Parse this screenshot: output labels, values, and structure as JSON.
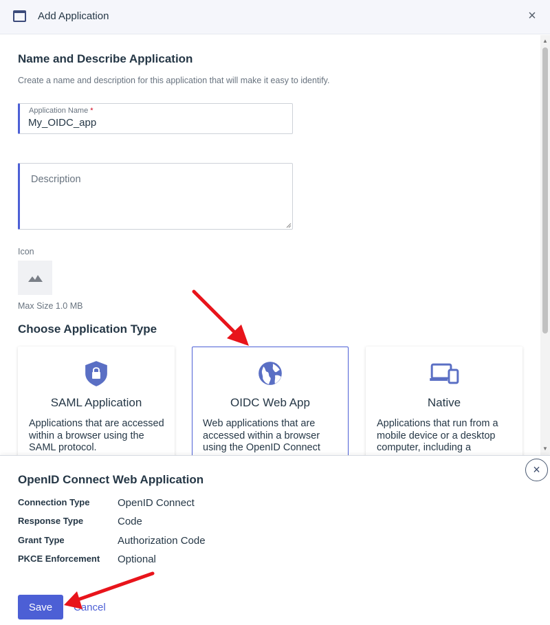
{
  "window": {
    "title": "Add Application",
    "icon": "window-icon",
    "close_icon": "×"
  },
  "form": {
    "heading": "Name and Describe Application",
    "subheading": "Create a name and description for this application that will make it easy to identify.",
    "app_name": {
      "label": "Application Name",
      "required_mark": "*",
      "value": "My_OIDC_app"
    },
    "description": {
      "placeholder": "Description",
      "value": ""
    },
    "icon": {
      "label": "Icon",
      "max_size": "Max Size 1.0 MB"
    }
  },
  "app_type": {
    "heading": "Choose Application Type",
    "cards": [
      {
        "name": "SAML Application",
        "icon": "shield-lock-icon",
        "description": "Applications that are accessed within a browser using the SAML protocol.",
        "selected": false
      },
      {
        "name": "OIDC Web App",
        "icon": "globe-icon",
        "description": "Web applications that are accessed within a browser using the OpenID Connect",
        "selected": true
      },
      {
        "name": "Native",
        "icon": "devices-icon",
        "description": "Applications that run from a mobile device or a desktop computer, including a",
        "selected": false
      }
    ]
  },
  "details_panel": {
    "title": "OpenID Connect Web Application",
    "close_icon": "×",
    "rows": [
      {
        "key": "Connection Type",
        "value": "OpenID Connect"
      },
      {
        "key": "Response Type",
        "value": "Code"
      },
      {
        "key": "Grant Type",
        "value": "Authorization Code"
      },
      {
        "key": "PKCE Enforcement",
        "value": "Optional"
      }
    ],
    "save_label": "Save",
    "cancel_label": "Cancel"
  },
  "colors": {
    "accent": "#4c5fd5",
    "text": "#253746",
    "muted": "#68737f",
    "arrow": "#e8141b",
    "icon": "#5a6fc4"
  }
}
